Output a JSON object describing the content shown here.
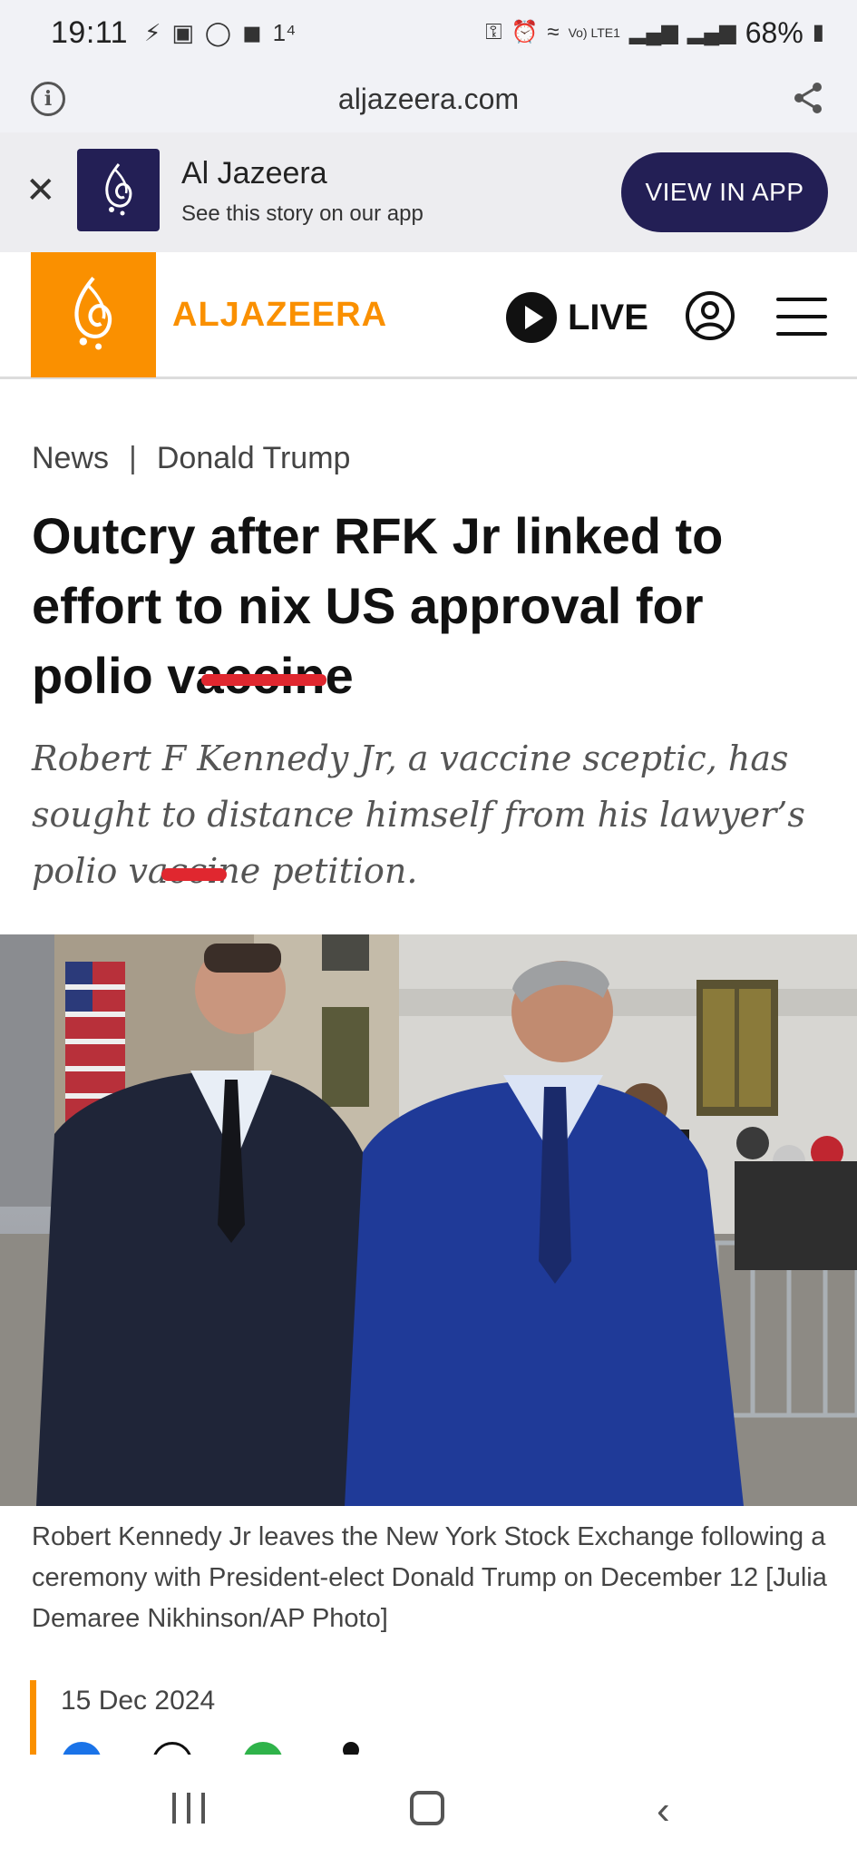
{
  "status_bar": {
    "time": "19:11",
    "notification_icons": [
      "messenger-icon",
      "square-app-icon",
      "facebook-icon",
      "video-icon",
      "1⁴"
    ],
    "right_icons": [
      "key-icon",
      "alarm-icon",
      "wifi-icon",
      "volte-icon",
      "signal-icon",
      "signal-icon"
    ],
    "volte_label": "Vo) LTE1",
    "battery": "68%"
  },
  "browser": {
    "url": "aljazeera.com"
  },
  "app_banner": {
    "title": "Al Jazeera",
    "subtitle": "See this story on our app",
    "button_label": "VIEW IN APP"
  },
  "site_header": {
    "wordmark": "ALJAZEERA",
    "live_label": "LIVE",
    "brand_color": "#fa9000",
    "navy_color": "#231f55"
  },
  "article": {
    "breadcrumb": [
      "News",
      "Donald Trump"
    ],
    "headline": "Outcry after RFK Jr linked to effort to nix US approval for polio vaccine",
    "standfirst": "Robert F Kennedy Jr, a vaccine sceptic, has sought to distance himself from his lawyer’s polio vaccine petition.",
    "image_caption": "Robert Kennedy Jr leaves the New York Stock Exchange following a ceremony with President-elect Donald Trump on December 12 [Julia Demaree Nikhinson/AP Photo]",
    "date": "15 Dec 2024",
    "markup_color": "#e0272f"
  },
  "nav_bar": {
    "buttons": [
      "recent-apps",
      "home",
      "back"
    ]
  }
}
